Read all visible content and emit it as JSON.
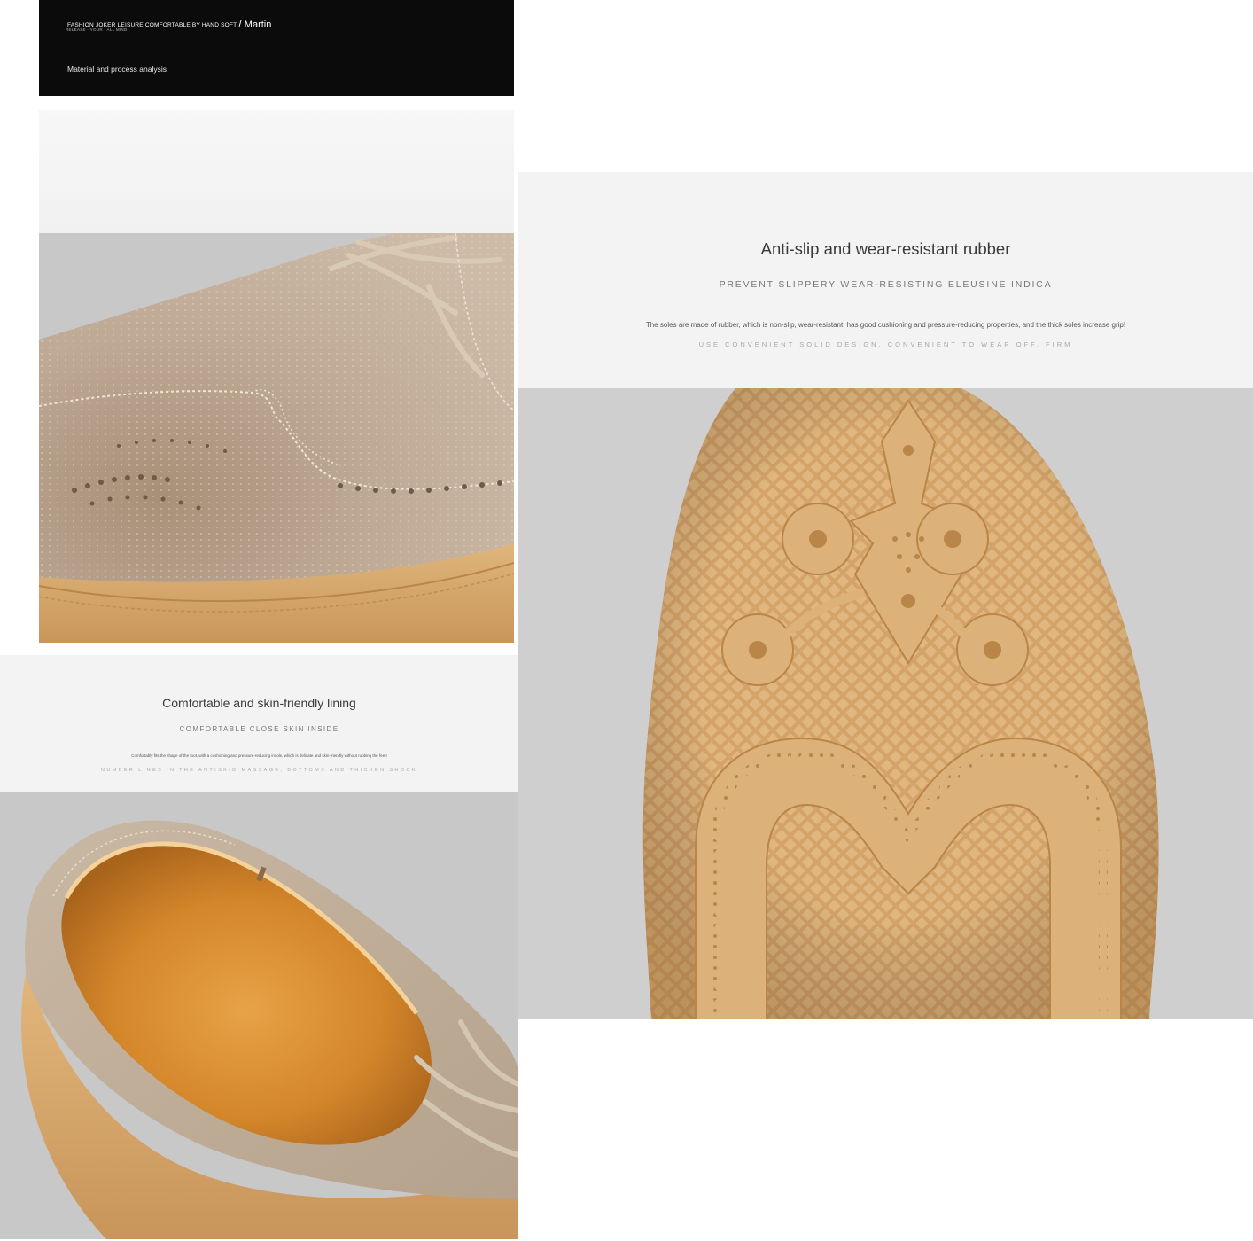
{
  "banner": {
    "tagline": "FASHION JOKER LEISURE COMFORTABLE BY HAND SOFT",
    "separator": "/",
    "brand": "Martin",
    "subline": "RELEASE · YOUR · ALL MIND",
    "analysis": "Material and process analysis"
  },
  "lining": {
    "heading": "Comfortable and skin-friendly lining",
    "caps": "COMFORTABLE CLOSE SKIN INSIDE",
    "body": "Comfortably fits the shape of the foot, with a cushioning and pressure-reducing insole, which is delicate and skin-friendly without rubbing the feet!",
    "faint": "NUMBER LINES IN THE ANTISKID MASSAGE, BOTTOMS AND THICKEN SHOCK"
  },
  "sole": {
    "heading": "Anti-slip and wear-resistant rubber",
    "caps": "PREVENT SLIPPERY WEAR-RESISTING ELEUSINE INDICA",
    "body": "The soles are made of rubber, which is non-slip, wear-resistant, has good cushioning and pressure-reducing properties, and the thick soles increase grip!",
    "faint": "USE CONVENIENT SOLID DESIGN, CONVENIENT TO WEAR OFF, FIRM"
  },
  "colors": {
    "suede": "#b9a48e",
    "rubber": "#d6a86a",
    "lining": "#d8942e",
    "backdrop": "#c9c9c9"
  }
}
